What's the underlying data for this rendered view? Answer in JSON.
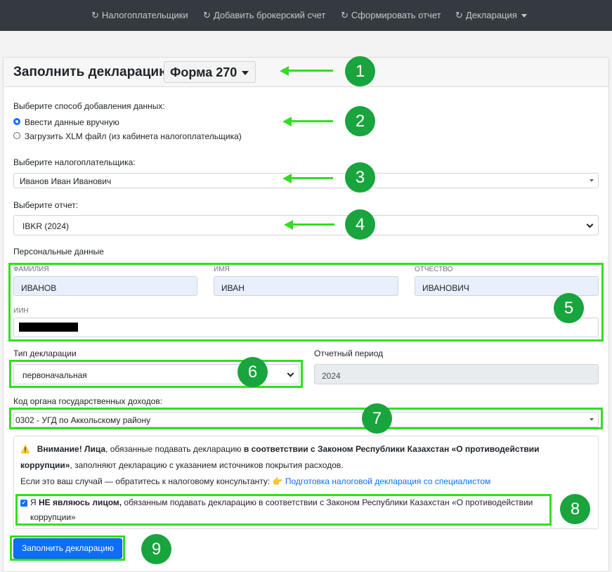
{
  "nav": {
    "items": [
      {
        "icon": "↻",
        "label": "Налогоплательщики"
      },
      {
        "icon": "↻",
        "label": "Добавить брокерский счет"
      },
      {
        "icon": "↻",
        "label": "Сформировать отчет"
      },
      {
        "icon": "↻",
        "label": "Декларация"
      }
    ]
  },
  "header": {
    "title": "Заполнить декларацию",
    "form_label": "Форма 270"
  },
  "method": {
    "label": "Выберите способ добавления данных:",
    "options": [
      "Ввести данные вручную",
      "Загрузить XLM файл (из кабинета налогоплательщика)"
    ],
    "selected": 0
  },
  "taxpayer": {
    "label": "Выберите налогоплательщика:",
    "value": "Иванов Иван Иванович"
  },
  "report": {
    "label": "Выберите отчет:",
    "value": "IBKR (2024)"
  },
  "personal": {
    "label": "Персональные данные",
    "surname_label": "ФАМИЛИЯ",
    "surname": "ИВАНОВ",
    "name_label": "ИМЯ",
    "name": "ИВАН",
    "patronymic_label": "ОТЧЕСТВО",
    "patronymic": "ИВАНОВИЧ",
    "iin_label": "ИИН"
  },
  "decl_type": {
    "label": "Тип декларации",
    "value": "первоначальная"
  },
  "period": {
    "label": "Отчетный период",
    "value": "2024"
  },
  "authority": {
    "label": "Код органа государственных доходов:",
    "value": "0302 - УГД по Аккольскому району"
  },
  "warning": {
    "icon": "⚠️",
    "bold1": "Внимание! Лица",
    "text1": ", обязанные подавать декларацию ",
    "bold2": "в соответствии с Законом Республики Казахстан «О противодействии",
    "bold3": "коррупции»",
    "text2": ", заполняют декларацию с указанием источников покрытия расходов.",
    "text3": "Если это ваш случай — обратитесь к налоговому консультанту:",
    "hand": "👉",
    "link": "Подготовка налоговой декларация со специалистом"
  },
  "confirm": {
    "prefix": "Я ",
    "bold": "НЕ являюсь лицом,",
    "text": " обязанным подавать декларацию в соответствии с Законом Республики Казахстан «О противодействии",
    "text2": "коррупции»",
    "checked": true
  },
  "submit_label": "Заполнить декларацию",
  "annotations": [
    "1",
    "2",
    "3",
    "4",
    "5",
    "6",
    "7",
    "8",
    "9"
  ],
  "colors": {
    "nav_bg": "#343a40",
    "accent": "#0d6efd",
    "highlight": "#33dd22",
    "badge": "#19a43d"
  }
}
